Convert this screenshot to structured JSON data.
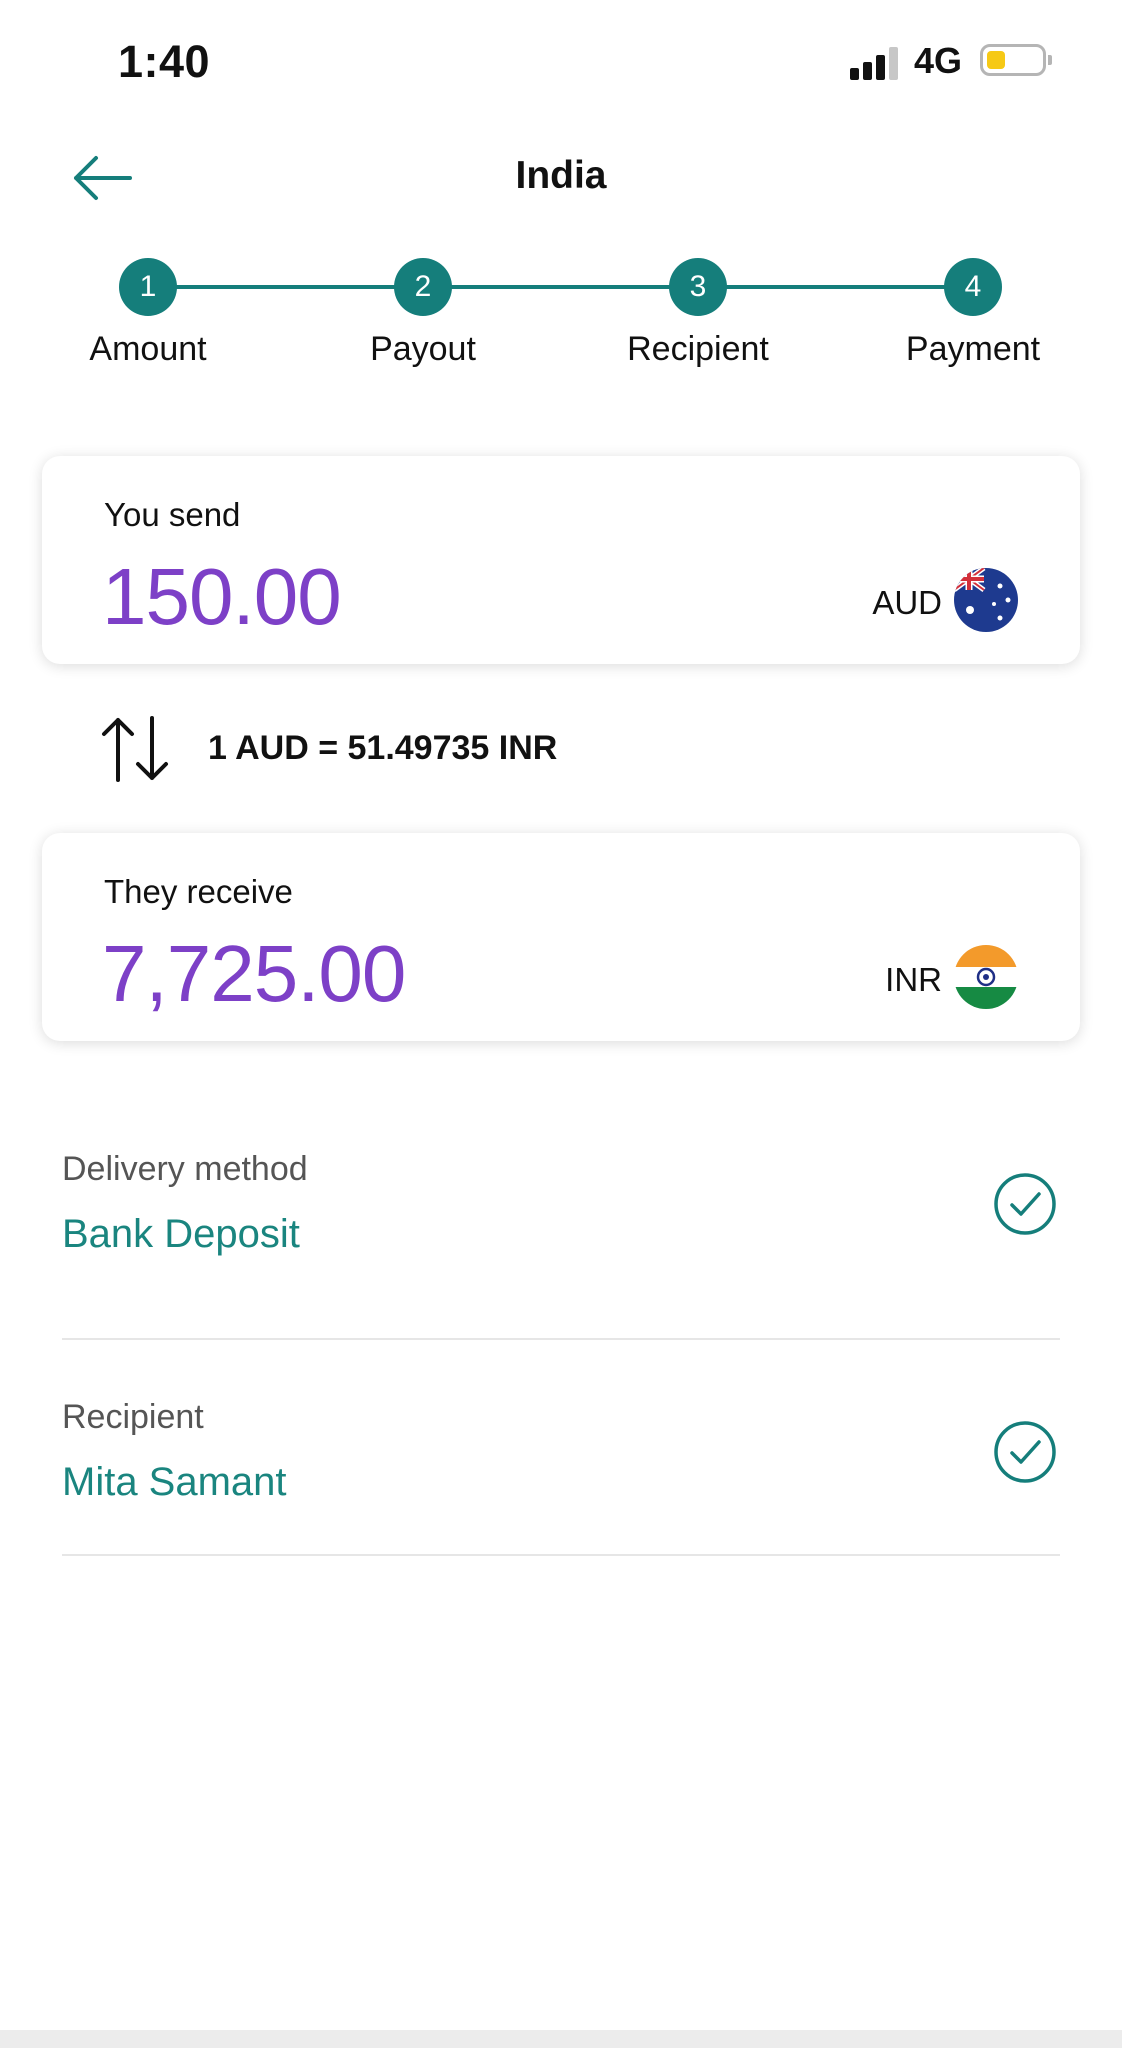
{
  "status_bar": {
    "time": "1:40",
    "network": "4G"
  },
  "header": {
    "title": "India"
  },
  "stepper": {
    "steps": [
      {
        "number": "1",
        "label": "Amount"
      },
      {
        "number": "2",
        "label": "Payout"
      },
      {
        "number": "3",
        "label": "Recipient"
      },
      {
        "number": "4",
        "label": "Payment"
      }
    ]
  },
  "send": {
    "label": "You send",
    "amount": "150.00",
    "currency": "AUD",
    "flag_icon": "australia-flag-icon"
  },
  "rate": {
    "text": "1 AUD = 51.49735 INR"
  },
  "receive": {
    "label": "They receive",
    "amount": "7,725.00",
    "currency": "INR",
    "flag_icon": "india-flag-icon"
  },
  "delivery": {
    "label": "Delivery method",
    "value": "Bank Deposit"
  },
  "recipient": {
    "label": "Recipient",
    "value": "Mita Samant"
  },
  "colors": {
    "accent": "#157e7b",
    "amount": "#7d40c7",
    "value_text": "#1a857f"
  }
}
